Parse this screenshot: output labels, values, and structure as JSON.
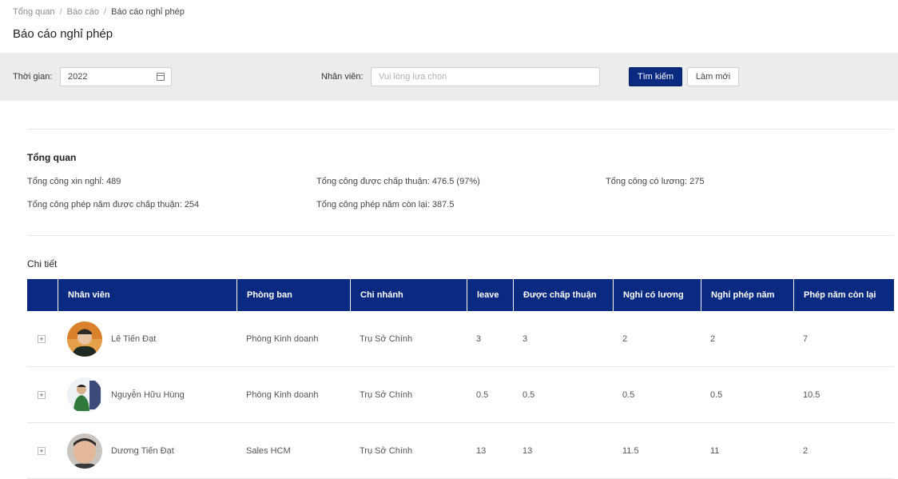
{
  "breadcrumb": [
    "Tổng quan",
    "Báo cáo",
    "Báo cáo nghỉ phép"
  ],
  "page_title": "Báo cáo nghỉ phép",
  "filters": {
    "time_label": "Thời gian:",
    "time_value": "2022",
    "staff_label": "Nhân viên:",
    "staff_placeholder": "Vui lòng lựa chọn",
    "search_button": "Tìm kiếm",
    "reset_button": "Làm mới"
  },
  "overview": {
    "title": "Tổng quan",
    "requested": "Tổng công xin nghỉ: 489",
    "approved": "Tổng công được chấp thuận: 476.5 (97%)",
    "paid": "Tổng công có lương: 275",
    "annual_approved": "Tổng công phép năm được chấp thuận: 254",
    "annual_remaining": "Tổng công phép năm còn lại: 387.5"
  },
  "details": {
    "title": "Chi tiết",
    "columns": [
      "Nhân viên",
      "Phòng ban",
      "Chi nhánh",
      "leave",
      "Được chấp thuận",
      "Nghỉ có lương",
      "Nghỉ phép năm",
      "Phép năm còn lại"
    ],
    "rows": [
      {
        "name": "Lê Tiến Đạt",
        "department": "Phòng Kinh doanh",
        "branch": "Trụ Sở Chính",
        "leave": "3",
        "approved": "3",
        "paid": "2",
        "annual": "2",
        "remaining": "7"
      },
      {
        "name": "Nguyễn Hữu Hùng",
        "department": "Phòng Kinh doanh",
        "branch": "Trụ Sở Chính",
        "leave": "0.5",
        "approved": "0.5",
        "paid": "0.5",
        "annual": "0.5",
        "remaining": "10.5"
      },
      {
        "name": "Dương Tiến Đạt",
        "department": "Sales HCM",
        "branch": "Trụ Sở Chính",
        "leave": "13",
        "approved": "13",
        "paid": "11.5",
        "annual": "11",
        "remaining": "2"
      }
    ]
  },
  "colors": {
    "primary": "#0a2a82",
    "filter_bg": "#ececec"
  }
}
